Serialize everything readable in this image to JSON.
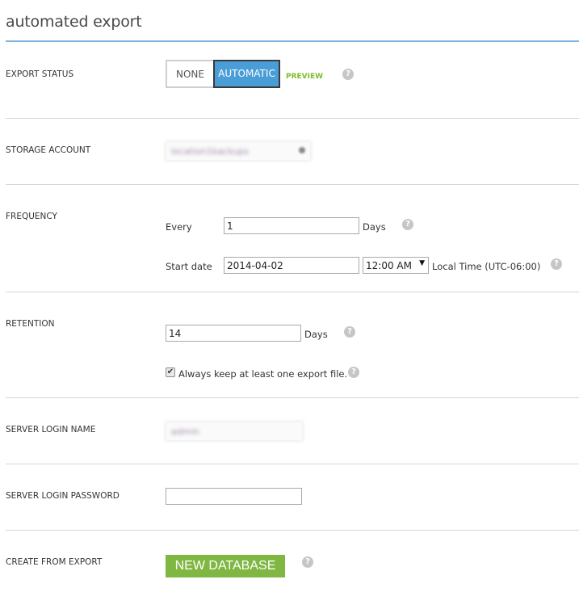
{
  "title": "automated export",
  "colors": {
    "accent_blue": "#4a9ed8",
    "title_rule": "#84b4de",
    "preview_green": "#7cbd2a",
    "button_green": "#7fb742",
    "help_icon_gray": "#c6c6c6"
  },
  "export_status": {
    "label": "EXPORT STATUS",
    "options": [
      "NONE",
      "AUTOMATIC"
    ],
    "selected": "AUTOMATIC",
    "badge": "PREVIEW",
    "help_icon": "question-circle-icon"
  },
  "storage_account": {
    "label": "STORAGE ACCOUNT",
    "value": "location1backups",
    "value_redacted": true
  },
  "frequency": {
    "label": "FREQUENCY",
    "every_label": "Every",
    "every_value": "1",
    "every_unit": "Days",
    "start_date_label": "Start date",
    "start_date_value": "2014-04-02",
    "start_time_value": "12:00 AM",
    "timezone_text": "Local Time (UTC-06:00)"
  },
  "retention": {
    "label": "RETENTION",
    "value": "14",
    "unit": "Days",
    "keep_one_checked": true,
    "keep_one_label": "Always keep at least one export file."
  },
  "server_login_name": {
    "label": "SERVER LOGIN NAME",
    "value": "admin",
    "value_redacted": true
  },
  "server_login_password": {
    "label": "SERVER LOGIN PASSWORD",
    "value": ""
  },
  "create_from_export": {
    "label": "CREATE FROM EXPORT",
    "button_label": "NEW DATABASE"
  },
  "icons": {
    "help_glyph": "?",
    "dropdown_glyph": "▼",
    "check_glyph": "✔"
  }
}
